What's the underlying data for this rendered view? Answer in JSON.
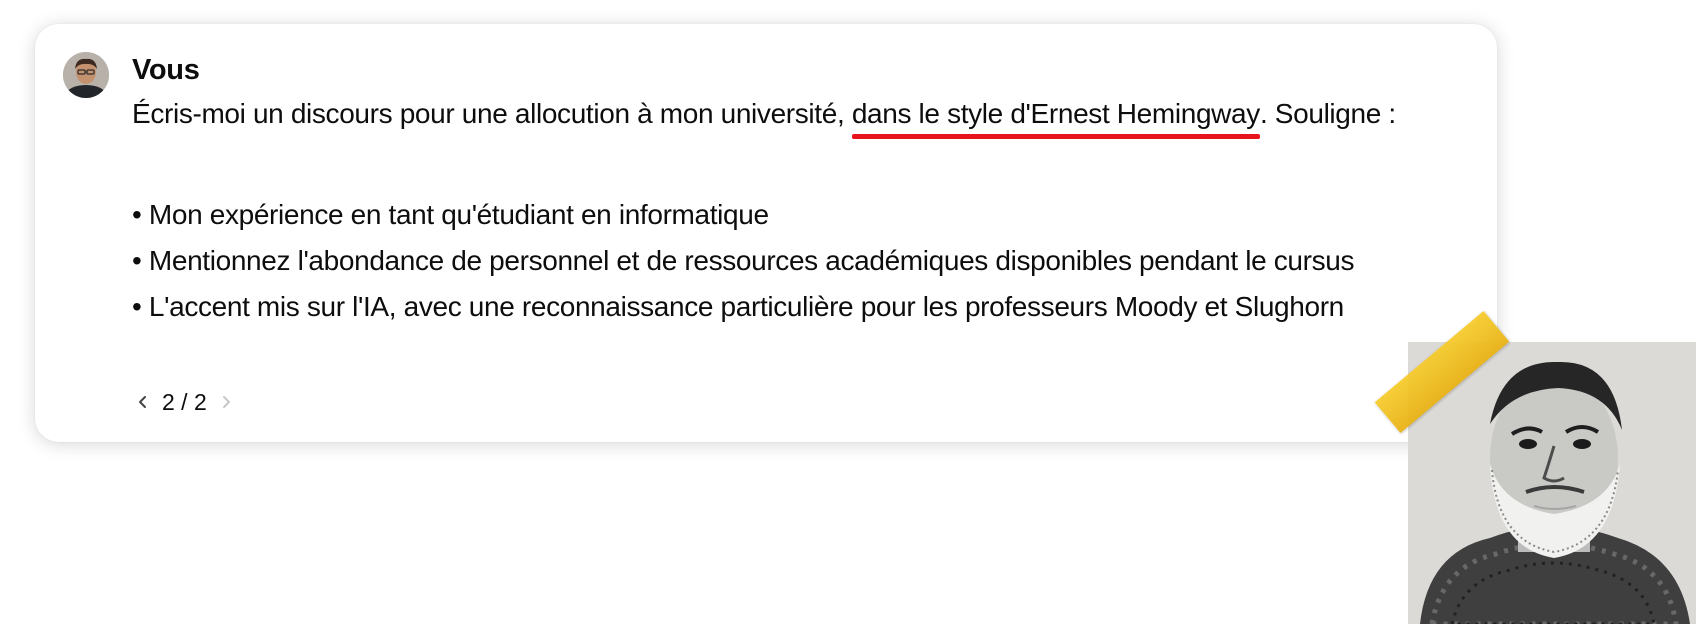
{
  "message": {
    "author": "Vous",
    "prompt_before": "Écris-moi un discours pour une allocution à mon université, ",
    "prompt_highlight": "dans le style d'Ernest Hemingway",
    "prompt_after": ". Souligne :",
    "bullets": [
      "• Mon expérience en tant qu'étudiant en informatique",
      "• Mentionnez l'abondance de personnel et de ressources académiques disponibles pendant le cursus",
      "• L'accent mis sur l'IA, avec une reconnaissance particulière pour les professeurs Moody et Slughorn"
    ],
    "pager": {
      "label": "2 / 2",
      "prev_icon": "chevron-left-icon",
      "next_icon": "chevron-right-icon"
    }
  },
  "colors": {
    "underline": "#e8141c",
    "tape": "#f3c320",
    "text": "#0d0d0d",
    "disabled": "#c7c7c7"
  }
}
